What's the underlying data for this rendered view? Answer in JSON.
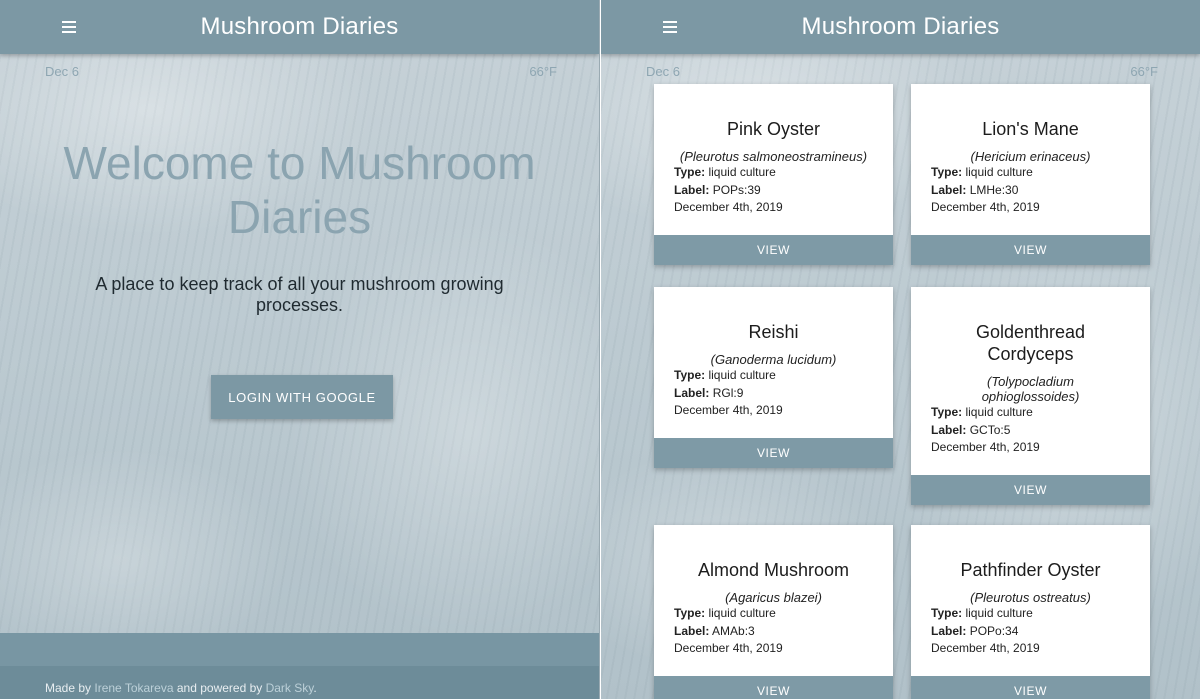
{
  "app_title": "Mushroom Diaries",
  "meta": {
    "date": "Dec 6",
    "temperature": "66°F"
  },
  "welcome": {
    "heading": "Welcome to Mushroom Diaries",
    "tagline": "A place to keep track of all your mushroom growing processes.",
    "login_label": "LOGIN WITH GOOGLE"
  },
  "footer": {
    "made_by_prefix": "Made by ",
    "author": "Irene Tokareva",
    "powered_by": " and powered by ",
    "service": "Dark Sky",
    "suffix": "."
  },
  "labels": {
    "type": "Type:",
    "label": "Label:",
    "view": "VIEW"
  },
  "cultures": [
    {
      "name": "Pink Oyster",
      "scientific": "(Pleurotus salmoneostramineus)",
      "type": "liquid culture",
      "label": "POPs:39",
      "date": "December 4th, 2019"
    },
    {
      "name": "Lion's Mane",
      "scientific": "(Hericium erinaceus)",
      "type": "liquid culture",
      "label": "LMHe:30",
      "date": "December 4th, 2019"
    },
    {
      "name": "Reishi",
      "scientific": "(Ganoderma lucidum)",
      "type": "liquid culture",
      "label": "RGl:9",
      "date": "December 4th, 2019"
    },
    {
      "name": "Goldenthread Cordyceps",
      "scientific": "(Tolypocladium ophioglossoides)",
      "type": "liquid culture",
      "label": "GCTo:5",
      "date": "December 4th, 2019"
    },
    {
      "name": "Almond Mushroom",
      "scientific": "(Agaricus blazei)",
      "type": "liquid culture",
      "label": "AMAb:3",
      "date": "December 4th, 2019"
    },
    {
      "name": "Pathfinder Oyster",
      "scientific": "(Pleurotus ostreatus)",
      "type": "liquid culture",
      "label": "POPo:34",
      "date": "December 4th, 2019"
    }
  ]
}
